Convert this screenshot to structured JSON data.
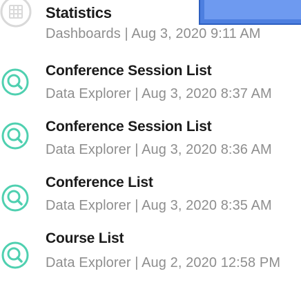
{
  "items": [
    {
      "title": "Statistics",
      "subtitle": "Dashboards | Aug 3, 2020 9:11 AM",
      "icon": "dashboard-app-icon",
      "has_thumbnail": true
    },
    {
      "title": "Conference Session List",
      "subtitle": "Data Explorer | Aug 3, 2020 8:37 AM",
      "icon": "data-explorer-icon"
    },
    {
      "title": "Conference Session List",
      "subtitle": "Data Explorer | Aug 3, 2020 8:36 AM",
      "icon": "data-explorer-icon"
    },
    {
      "title": "Conference List",
      "subtitle": "Data Explorer | Aug 3, 2020 8:35 AM",
      "icon": "data-explorer-icon"
    },
    {
      "title": "Course List",
      "subtitle": "Data Explorer | Aug 2, 2020 12:58 PM",
      "icon": "data-explorer-icon"
    }
  ],
  "colors": {
    "dashboard_icon": "#d9d9d9",
    "explorer_icon": "#4fd0b0",
    "thumbnail": "#4d7fe0"
  }
}
